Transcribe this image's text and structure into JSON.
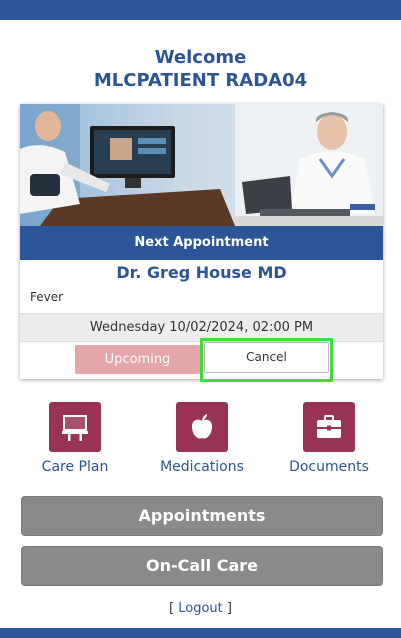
{
  "header": {
    "welcome": "Welcome",
    "patient_name": "MLCPATIENT RADA04"
  },
  "appointment_card": {
    "bar_label": "Next Appointment",
    "doctor": "Dr. Greg House MD",
    "reason": "Fever",
    "datetime": "Wednesday 10/02/2024, 02:00 PM",
    "status_label": "Upcoming",
    "cancel_label": "Cancel"
  },
  "quick_links": [
    {
      "label": "Care Plan",
      "icon": "whiteboard-icon"
    },
    {
      "label": "Medications",
      "icon": "apple-icon"
    },
    {
      "label": "Documents",
      "icon": "briefcase-icon"
    }
  ],
  "actions": {
    "appointments": "Appointments",
    "on_call_care": "On-Call Care"
  },
  "footer": {
    "logout_open": "[ ",
    "logout": "Logout",
    "logout_close": " ]"
  },
  "colors": {
    "primary": "#2b5597",
    "tile": "#993356",
    "upcoming": "#e4a6a8",
    "highlight": "#3ede3a",
    "button_gray": "#8a8a8a"
  }
}
